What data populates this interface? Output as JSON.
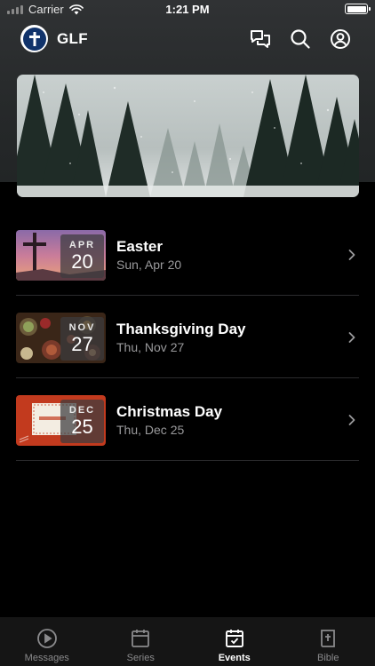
{
  "status_bar": {
    "carrier": "Carrier",
    "time": "1:21 PM"
  },
  "header": {
    "app_name": "GLF",
    "icons": [
      "cross-logo-icon",
      "chat-icon",
      "search-icon",
      "profile-icon"
    ]
  },
  "hero": {
    "image": "snowy-forest"
  },
  "events": [
    {
      "title": "Easter",
      "date": "Sun, Apr 20",
      "badge_month": "APR",
      "badge_day": "20",
      "thumbnail": "cross-sunset"
    },
    {
      "title": "Thanksgiving Day",
      "date": "Thu, Nov 27",
      "badge_month": "NOV",
      "badge_day": "27",
      "thumbnail": "harvest-table"
    },
    {
      "title": "Christmas Day",
      "date": "Thu, Dec 25",
      "badge_month": "DEC",
      "badge_day": "25",
      "thumbnail": "christmas-card"
    }
  ],
  "tab_bar": {
    "tabs": [
      {
        "label": "Messages",
        "icon": "play-circle-icon",
        "active": false
      },
      {
        "label": "Series",
        "icon": "calendar-icon",
        "active": false
      },
      {
        "label": "Events",
        "icon": "calendar-check-icon",
        "active": true
      },
      {
        "label": "Bible",
        "icon": "bible-icon",
        "active": false
      }
    ]
  },
  "colors": {
    "background": "#000000",
    "header_bg": "#2a2d2e",
    "tab_bar_bg": "#151515",
    "active_tab": "#ffffff",
    "inactive_tab": "#8a8a8c",
    "secondary_text": "#9a9a9c",
    "logo_blue": "#11336b"
  }
}
